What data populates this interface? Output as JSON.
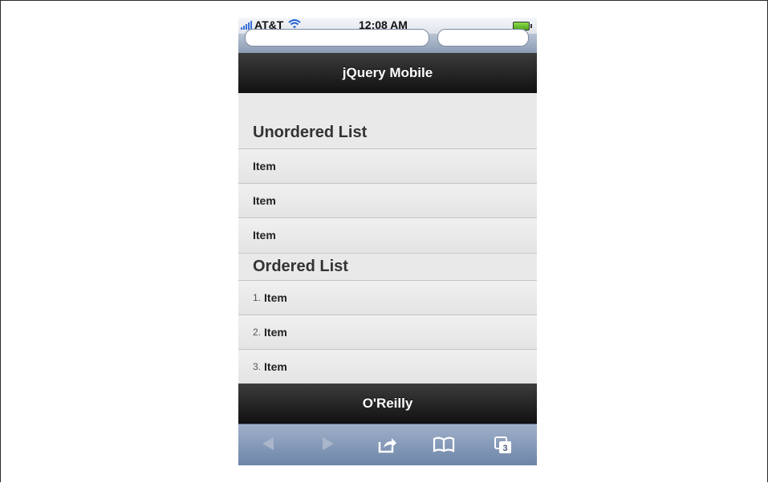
{
  "status_bar": {
    "carrier": "AT&T",
    "time": "12:08 AM"
  },
  "header": {
    "title": "jQuery Mobile"
  },
  "unordered_list": {
    "heading": "Unordered List",
    "items": [
      "Item",
      "Item",
      "Item"
    ]
  },
  "ordered_list": {
    "heading": "Ordered List",
    "items": [
      {
        "number": "1.",
        "label": "Item"
      },
      {
        "number": "2.",
        "label": "Item"
      },
      {
        "number": "3.",
        "label": "Item"
      }
    ]
  },
  "footer": {
    "title": "O'Reilly"
  },
  "toolbar": {
    "tabs_count": "3",
    "icons": [
      "back-icon",
      "forward-icon",
      "share-icon",
      "bookmarks-icon",
      "tabs-icon"
    ]
  },
  "colors": {
    "bar_dark": "#1a1a1a",
    "content_bg": "#e9e9e9",
    "toolbar_blue": "#7f95b7"
  }
}
